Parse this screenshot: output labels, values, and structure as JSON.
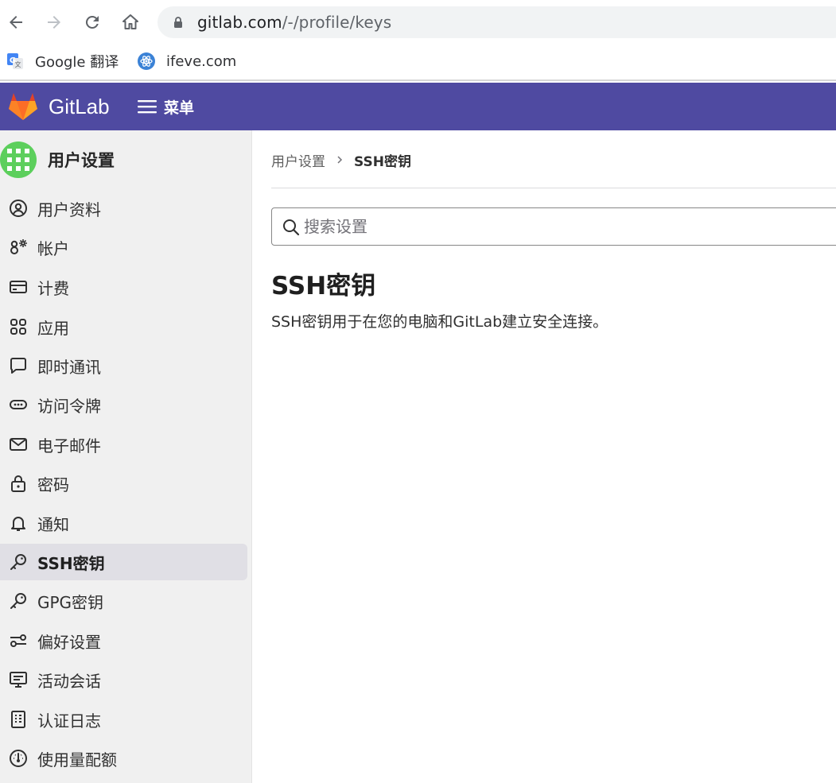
{
  "browser": {
    "url_host": "gitlab.com",
    "url_path": "/-/profile/keys",
    "bookmarks": [
      {
        "label": "Google 翻译",
        "icon": "google-translate-icon"
      },
      {
        "label": "ifeve.com",
        "icon": "atom-icon"
      }
    ]
  },
  "header": {
    "brand": "GitLab",
    "menu_label": "菜单",
    "color": "#4f4aa1"
  },
  "sidebar": {
    "title": "用户设置",
    "items": [
      {
        "label": "用户资料",
        "icon": "user-circle-icon"
      },
      {
        "label": "帐户",
        "icon": "account-gear-icon"
      },
      {
        "label": "计费",
        "icon": "credit-card-icon"
      },
      {
        "label": "应用",
        "icon": "applications-grid-icon"
      },
      {
        "label": "即时通讯",
        "icon": "chat-bubble-icon"
      },
      {
        "label": "访问令牌",
        "icon": "token-icon"
      },
      {
        "label": "电子邮件",
        "icon": "envelope-icon"
      },
      {
        "label": "密码",
        "icon": "lock-icon"
      },
      {
        "label": "通知",
        "icon": "bell-icon"
      },
      {
        "label": "SSH密钥",
        "icon": "key-icon",
        "active": true
      },
      {
        "label": "GPG密钥",
        "icon": "key-icon"
      },
      {
        "label": "偏好设置",
        "icon": "preferences-icon"
      },
      {
        "label": "活动会话",
        "icon": "monitor-icon"
      },
      {
        "label": "认证日志",
        "icon": "log-list-icon"
      },
      {
        "label": "使用量配额",
        "icon": "gauge-icon"
      }
    ]
  },
  "main": {
    "breadcrumb": [
      "用户设置",
      "SSH密钥"
    ],
    "search_placeholder": "搜索设置",
    "title": "SSH密钥",
    "description": "SSH密钥用于在您的电脑和GitLab建立安全连接。"
  }
}
